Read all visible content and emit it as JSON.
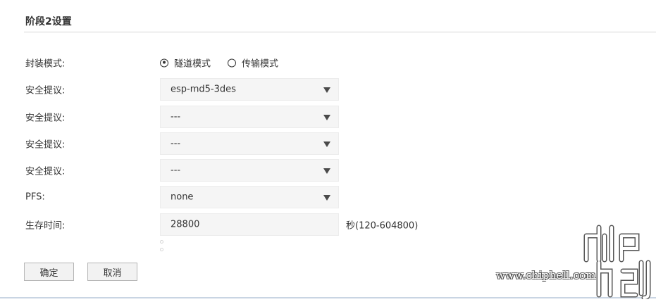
{
  "section": {
    "title": "阶段2设置"
  },
  "encapsulation": {
    "label": "封装模式:",
    "options": [
      {
        "label": "隧道模式",
        "checked": true
      },
      {
        "label": "传输模式",
        "checked": false
      }
    ]
  },
  "proposals": [
    {
      "label": "安全提议:",
      "value": "esp-md5-3des"
    },
    {
      "label": "安全提议:",
      "value": "---"
    },
    {
      "label": "安全提议:",
      "value": "---"
    },
    {
      "label": "安全提议:",
      "value": "---"
    }
  ],
  "pfs": {
    "label": "PFS:",
    "value": "none"
  },
  "lifetime": {
    "label": "生存时间:",
    "value": "28800",
    "suffix": "秒(120-604800)"
  },
  "buttons": {
    "ok": "确定",
    "cancel": "取消"
  },
  "watermark": {
    "url": "www.chiphell.com",
    "logo": "chip hell"
  }
}
